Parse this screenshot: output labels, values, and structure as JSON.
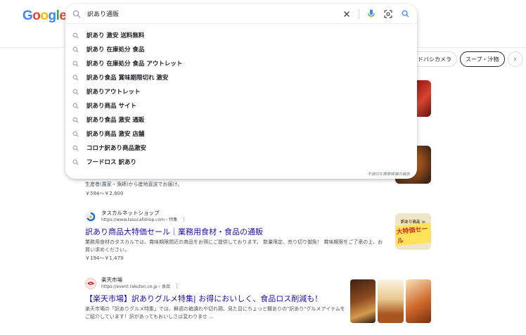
{
  "logo": {
    "letters": [
      "G",
      "o",
      "o",
      "g",
      "l",
      "e"
    ]
  },
  "search": {
    "query": "訳あり通販",
    "suggestions": [
      "訳あり 激安 送料無料",
      "訳あり 在庫処分 食品",
      "訳あり 在庫処分 食品 アウトレット",
      "訳あり食品 賞味期限切れ 激安",
      "訳ありアウトレット",
      "訳あり商品 サイト",
      "訳あり食品 激安 通販",
      "訳あり商品 激安 店舗",
      "コロナ訳あり商品激安",
      "フードロス 訳あり"
    ],
    "report_link": "不適切な検索候補の報告"
  },
  "chips": [
    "ヨドバシカメラ",
    "スープ・汁物"
  ],
  "icons": {
    "search": "search-icon",
    "clear": "close-icon",
    "voice": "microphone-icon",
    "lens": "camera-lens-icon",
    "submit": "search-icon",
    "chevron": "chevron-right-icon"
  },
  "partial_result": {
    "snippet_tail": "生産者(農家・漁師)から産地直送でお届け。",
    "price": "￥594〜￥2,800"
  },
  "results": [
    {
      "site_name": "タスカルネットショップ",
      "url": "https://www.tasucallshop.com › 特集",
      "title": "訳あり商品大特価セール｜業務用食材・食品の通販",
      "desc": "業務用食材のタスカルでは、賞味期限間近の商品をお得にご提供しております。 数量限定、売り切り御免！ 賞味期限をご了承の上、お買い求めください。",
      "price": "￥194〜￥1,479",
      "thumb_top": "訳あり商品 ≫",
      "thumb_big": "大特価セール"
    },
    {
      "site_name": "楽天市場",
      "url": "https://event.rakuten.co.jp › 食品",
      "title": "【楽天市場】訳ありグルメ特集| お得においしく、食品ロス削減も！",
      "desc": "楽天市場の「訳ありグルメ特集」では、鮮週の箱潰れや切れ鶏、見た目にちょっと難ありの\"訳あり\"グルメアイテムをご紹介しています！訳があってもおいしさは変わりませ ..."
    }
  ],
  "colors": {
    "link": "#1a0dab",
    "accent_blue": "#4285f4",
    "accent_red": "#ea4335",
    "accent_yellow": "#fbbc05",
    "accent_green": "#34a853"
  }
}
